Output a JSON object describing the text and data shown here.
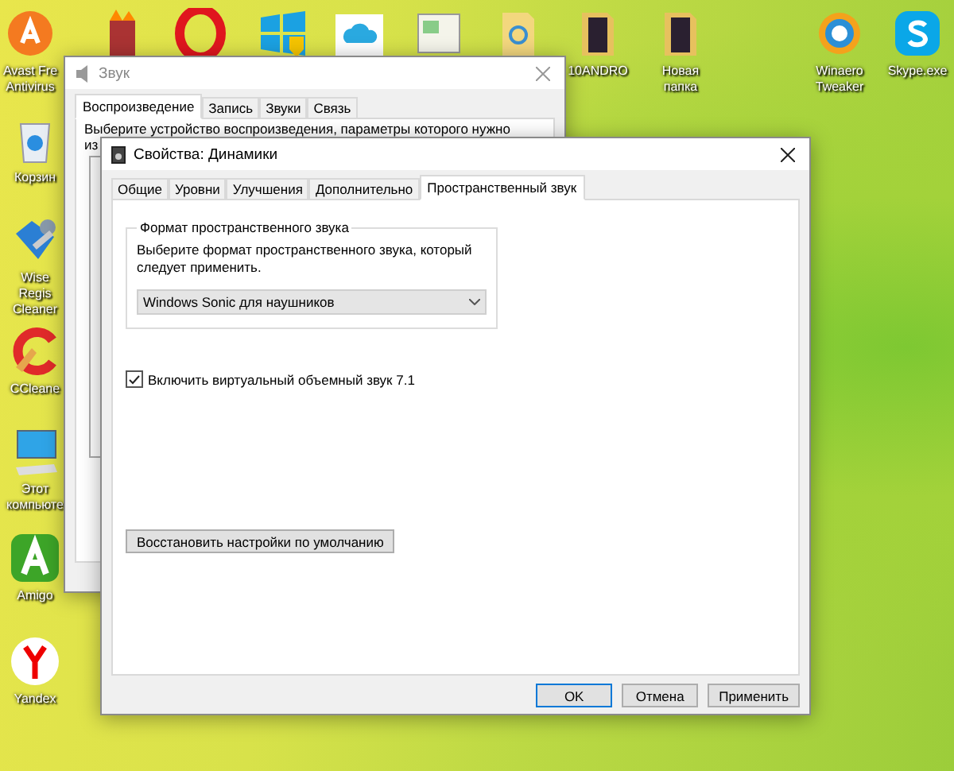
{
  "desktop_icons": [
    {
      "kind": "avast",
      "label": "Avast Fre Antivirus"
    },
    {
      "kind": "tower"
    },
    {
      "kind": "opera"
    },
    {
      "kind": "windows"
    },
    {
      "kind": "cloud"
    },
    {
      "kind": "file"
    },
    {
      "kind": "folder"
    },
    {
      "kind": "folder-dark",
      "label": "10ANDRO"
    },
    {
      "kind": "folder-dark",
      "label": "Новая папка"
    },
    {
      "kind": "winaero",
      "label": "Winaero Tweaker"
    },
    {
      "kind": "skype",
      "label": "Skype.exe"
    },
    {
      "kind": "recycle",
      "label": "Корзин"
    },
    {
      "kind": "wise",
      "label": "Wise Regis Cleaner"
    },
    {
      "kind": "ccleaner",
      "label": "CCleane"
    },
    {
      "kind": "computer",
      "label": "Этот компьюте"
    },
    {
      "kind": "amigo",
      "label": "Amigo"
    },
    {
      "kind": "yandex",
      "label": "Yandex"
    }
  ],
  "sound_window": {
    "title": "Звук",
    "tabs": [
      {
        "label": "Воспроизведение",
        "selected": true
      },
      {
        "label": "Запись",
        "selected": false
      },
      {
        "label": "Звуки",
        "selected": false
      },
      {
        "label": "Связь",
        "selected": false
      }
    ],
    "instruction": "Выберите устройство воспроизведения, параметры которого нужно",
    "instruction_cut": "из"
  },
  "properties_window": {
    "title": "Свойства: Динамики",
    "tabs": [
      {
        "label": "Общие",
        "selected": false
      },
      {
        "label": "Уровни",
        "selected": false
      },
      {
        "label": "Улучшения",
        "selected": false
      },
      {
        "label": "Дополнительно",
        "selected": false
      },
      {
        "label": "Пространственный звук",
        "selected": true
      }
    ],
    "group_title": "Формат пространственного звука",
    "group_text": "Выберите формат пространственного звука, который следует применить.",
    "format_select": {
      "value": "Windows Sonic для наушников"
    },
    "virtual_surround": {
      "label": "Включить виртуальный объемный звук 7.1",
      "checked": true
    },
    "restore_button": "Восстановить настройки по умолчанию",
    "buttons": [
      {
        "label": "OK",
        "default": true
      },
      {
        "label": "Отмена",
        "default": false
      },
      {
        "label": "Применить",
        "default": false
      }
    ]
  }
}
